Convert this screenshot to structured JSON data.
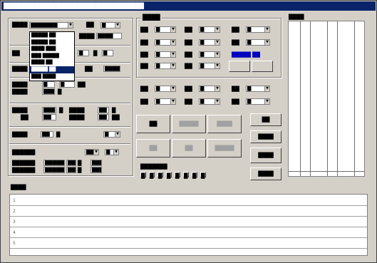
{
  "window": {
    "title": "████████████████████████████████"
  },
  "type_dropdown": {
    "label": "████",
    "selected": "███████",
    "options": [
      "█████ ██",
      "█████ ██",
      "████ ███",
      "███ █████",
      "████ ██",
      "█████ ██",
      "███ ████"
    ],
    "highlighted_index": 5
  },
  "form_left": {
    "row1": {
      "label": "██",
      "value": "█"
    },
    "row2": {
      "label": "████",
      "value": "████"
    },
    "row3": {
      "label": "██",
      "v1": "█",
      "mid": "█",
      "v2": "█"
    },
    "row4": {
      "label": "████",
      "tail_label": "██",
      "tail_value": "████"
    },
    "row5": {
      "label1": "████",
      "label2": "████",
      "v1": "█",
      "v2": "█",
      "v3": "███",
      "unit1": "██",
      "unit2": "█"
    },
    "row6": {
      "label1": "████",
      "label2": "██",
      "v1": "███",
      "v2": "██",
      "unit_a": "█",
      "unit_b": "████",
      "v3": "██",
      "unit_c": "█",
      "unit_d": "████",
      "v4": "██",
      "unit_e": "██"
    },
    "row7": {
      "label": "████",
      "value": "██",
      "unit": "█",
      "cb_value": "█"
    },
    "row8": {
      "label": "██████",
      "cb1": "██",
      "cb2": "█"
    },
    "row9": {
      "label1": "██████",
      "label2": "██████",
      "a1": "██████",
      "a2": "███",
      "a3": "█",
      "a4": "███",
      "b1": "██████",
      "b2": "███",
      "b3": "█",
      "b4": "███"
    }
  },
  "params": {
    "title": "████",
    "col1": [
      {
        "label": "██",
        "value": "█"
      },
      {
        "label": "██",
        "value": "█"
      },
      {
        "label": "██",
        "value": "█"
      },
      {
        "label": "██",
        "value": "█"
      }
    ],
    "col2": [
      {
        "label": "██",
        "value": "█"
      },
      {
        "label": "██",
        "value": "█"
      },
      {
        "label": "██",
        "value": "█"
      },
      {
        "label": "██",
        "value": "█"
      }
    ],
    "col3": [
      {
        "label": "██",
        "value": "█"
      },
      {
        "label": "██",
        "value": "█"
      }
    ],
    "blue_text": "█████ ██",
    "row_b": [
      {
        "label": "██",
        "value": "█"
      },
      {
        "label": "██",
        "value": "█"
      },
      {
        "label": "██",
        "value": "█"
      },
      {
        "label": "██",
        "value": "█"
      },
      {
        "label": "██",
        "value": "█"
      },
      {
        "label": "██",
        "value": "█"
      }
    ]
  },
  "actions": {
    "b1": "██",
    "b2": "█████",
    "b3": "████",
    "b4": "██",
    "b5": "██",
    "b6": "█████"
  },
  "digits": {
    "label": "███████",
    "keys": [
      "█",
      "█",
      "█",
      "█",
      "█",
      "█",
      "█",
      "█"
    ]
  },
  "right_buttons": [
    "██",
    "████",
    "████",
    "████"
  ],
  "results": {
    "title": "████"
  },
  "notes": {
    "title": "████",
    "row_numbers": [
      "1",
      "2",
      "3",
      "4",
      "5"
    ]
  }
}
